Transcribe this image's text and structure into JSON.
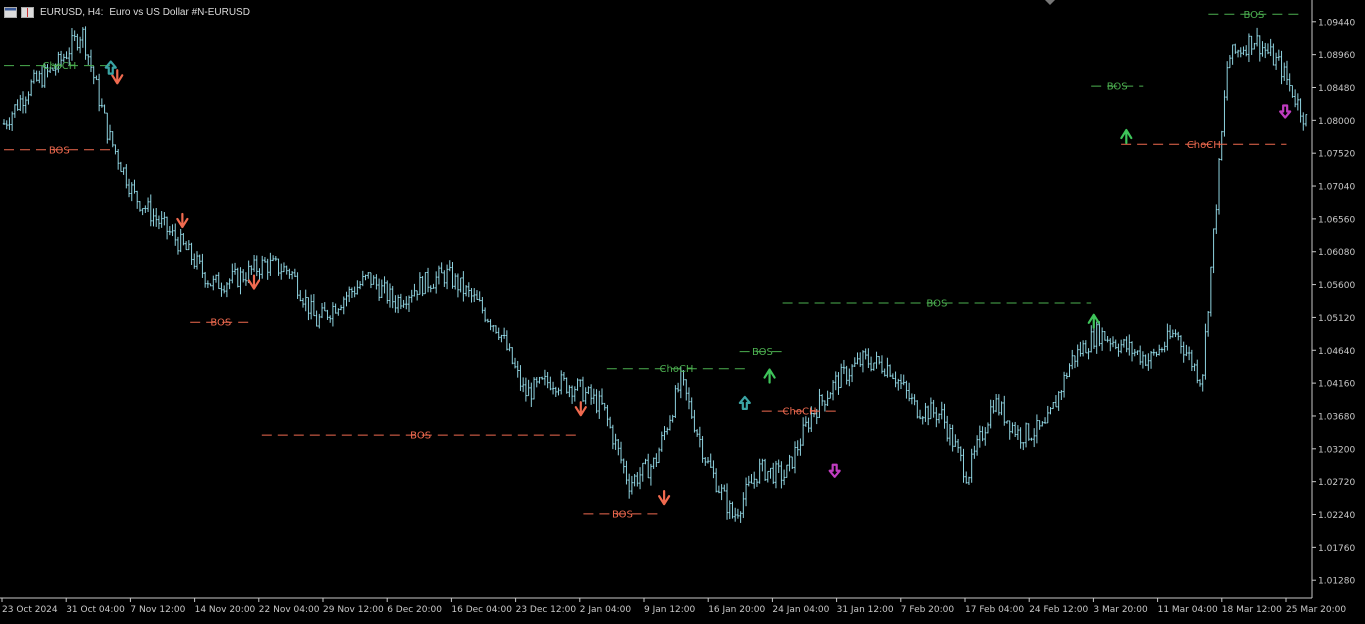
{
  "header": {
    "symbol_title": "EURUSD, H4:",
    "description": "Euro vs US Dollar #N-EURUSD"
  },
  "colors": {
    "background": "#000000",
    "candle": "#8fd3e0",
    "axis": "#c8c8c8",
    "bullish": "#4caf50",
    "bearish": "#f06a4f",
    "down_arrow": "#f06a4f",
    "up_arrow": "#3ec45a",
    "purple_arrow": "#c03cc0",
    "teal_arrow": "#3aa3a3"
  },
  "chart_data": {
    "type": "line",
    "title": "",
    "xlabel": "",
    "ylabel": "",
    "ylim": [
      1.0102,
      1.097
    ],
    "y_ticks": [
      "1.09440",
      "1.08960",
      "1.08480",
      "1.08000",
      "1.07520",
      "1.07040",
      "1.06560",
      "1.06080",
      "1.05600",
      "1.05120",
      "1.04640",
      "1.04160",
      "1.03680",
      "1.03200",
      "1.02720",
      "1.02240",
      "1.01760",
      "1.01280"
    ],
    "x_ticks": [
      "23 Oct 2024",
      "31 Oct 04:00",
      "7 Nov 12:00",
      "14 Nov 20:00",
      "22 Nov 04:00",
      "29 Nov 12:00",
      "6 Dec 20:00",
      "16 Dec 04:00",
      "23 Dec 12:00",
      "2 Jan 04:00",
      "9 Jan 12:00",
      "16 Jan 20:00",
      "24 Jan 04:00",
      "31 Jan 12:00",
      "7 Feb 20:00",
      "17 Feb 04:00",
      "24 Feb 12:00",
      "3 Mar 20:00",
      "11 Mar 04:00",
      "18 Mar 12:00",
      "25 Mar 20:00"
    ],
    "x": [
      0,
      0.02,
      0.04,
      0.06,
      0.08,
      0.1,
      0.12,
      0.14,
      0.16,
      0.18,
      0.2,
      0.22,
      0.24,
      0.26,
      0.28,
      0.3,
      0.32,
      0.34,
      0.36,
      0.38,
      0.4,
      0.42,
      0.44,
      0.46,
      0.48,
      0.5,
      0.52,
      0.54,
      0.56,
      0.58,
      0.6,
      0.62,
      0.64,
      0.66,
      0.68,
      0.7,
      0.72,
      0.74,
      0.76,
      0.78,
      0.8,
      0.82,
      0.84,
      0.86,
      0.88,
      0.9,
      0.92,
      0.94,
      0.96,
      0.98,
      1
    ],
    "series": [
      {
        "values": [
          1.0795,
          1.085,
          1.0878,
          1.093,
          1.078,
          1.069,
          1.065,
          1.061,
          1.056,
          1.057,
          1.059,
          1.058,
          1.0505,
          1.054,
          1.057,
          1.0535,
          1.056,
          1.0575,
          1.054,
          1.0495,
          1.04,
          1.042,
          1.041,
          1.038,
          1.027,
          1.03,
          1.042,
          1.03,
          1.022,
          1.029,
          1.028,
          1.037,
          1.042,
          1.045,
          1.044,
          1.038,
          1.037,
          1.028,
          1.039,
          1.034,
          1.035,
          1.045,
          1.049,
          1.047,
          1.045,
          1.049,
          1.042,
          1.089,
          1.092,
          1.088,
          1.08
        ]
      }
    ],
    "structure_levels": [
      {
        "label": "BOS",
        "kind": "bearish",
        "price": 1.0757,
        "x_start": 0.0,
        "x_end": 0.085
      },
      {
        "label": "BOS",
        "kind": "bearish",
        "price": 1.0505,
        "x_start": 0.143,
        "x_end": 0.19
      },
      {
        "label": "BOS",
        "kind": "bearish",
        "price": 1.034,
        "x_start": 0.198,
        "x_end": 0.442
      },
      {
        "label": "BOS",
        "kind": "bearish",
        "price": 1.0225,
        "x_start": 0.445,
        "x_end": 0.505
      },
      {
        "label": "ChoCH",
        "kind": "bullish",
        "price": 1.088,
        "x_start": 0.0,
        "x_end": 0.085
      },
      {
        "label": "ChoCH",
        "kind": "bullish",
        "price": 1.0437,
        "x_start": 0.463,
        "x_end": 0.57
      },
      {
        "label": "BOS",
        "kind": "bullish",
        "price": 1.0462,
        "x_start": 0.565,
        "x_end": 0.6
      },
      {
        "label": "BOS",
        "kind": "bullish",
        "price": 1.0533,
        "x_start": 0.598,
        "x_end": 0.835
      },
      {
        "label": "ChoCH",
        "kind": "bearish",
        "price": 1.0375,
        "x_start": 0.582,
        "x_end": 0.64
      },
      {
        "label": "BOS",
        "kind": "bullish",
        "price": 1.085,
        "x_start": 0.835,
        "x_end": 0.875
      },
      {
        "label": "BOS",
        "kind": "bullish",
        "price": 1.0955,
        "x_start": 0.925,
        "x_end": 0.995
      },
      {
        "label": "ChoCH",
        "kind": "bearish",
        "price": 1.0765,
        "x_start": 0.858,
        "x_end": 0.985
      }
    ],
    "signals": [
      {
        "kind": "down",
        "x": 0.087,
        "price": 1.086
      },
      {
        "kind": "down",
        "x": 0.137,
        "price": 1.065
      },
      {
        "kind": "down",
        "x": 0.192,
        "price": 1.056
      },
      {
        "kind": "down",
        "x": 0.443,
        "price": 1.0375
      },
      {
        "kind": "down",
        "x": 0.507,
        "price": 1.0245
      },
      {
        "kind": "up",
        "x": 0.588,
        "price": 1.043
      },
      {
        "kind": "up",
        "x": 0.862,
        "price": 1.078
      },
      {
        "kind": "up",
        "x": 0.837,
        "price": 1.051
      },
      {
        "kind": "purple-down",
        "x": 0.638,
        "price": 1.0285
      },
      {
        "kind": "purple-down",
        "x": 0.984,
        "price": 1.081
      },
      {
        "kind": "teal-up",
        "x": 0.569,
        "price": 1.039
      },
      {
        "kind": "teal-up",
        "x": 0.082,
        "price": 1.088
      }
    ]
  }
}
